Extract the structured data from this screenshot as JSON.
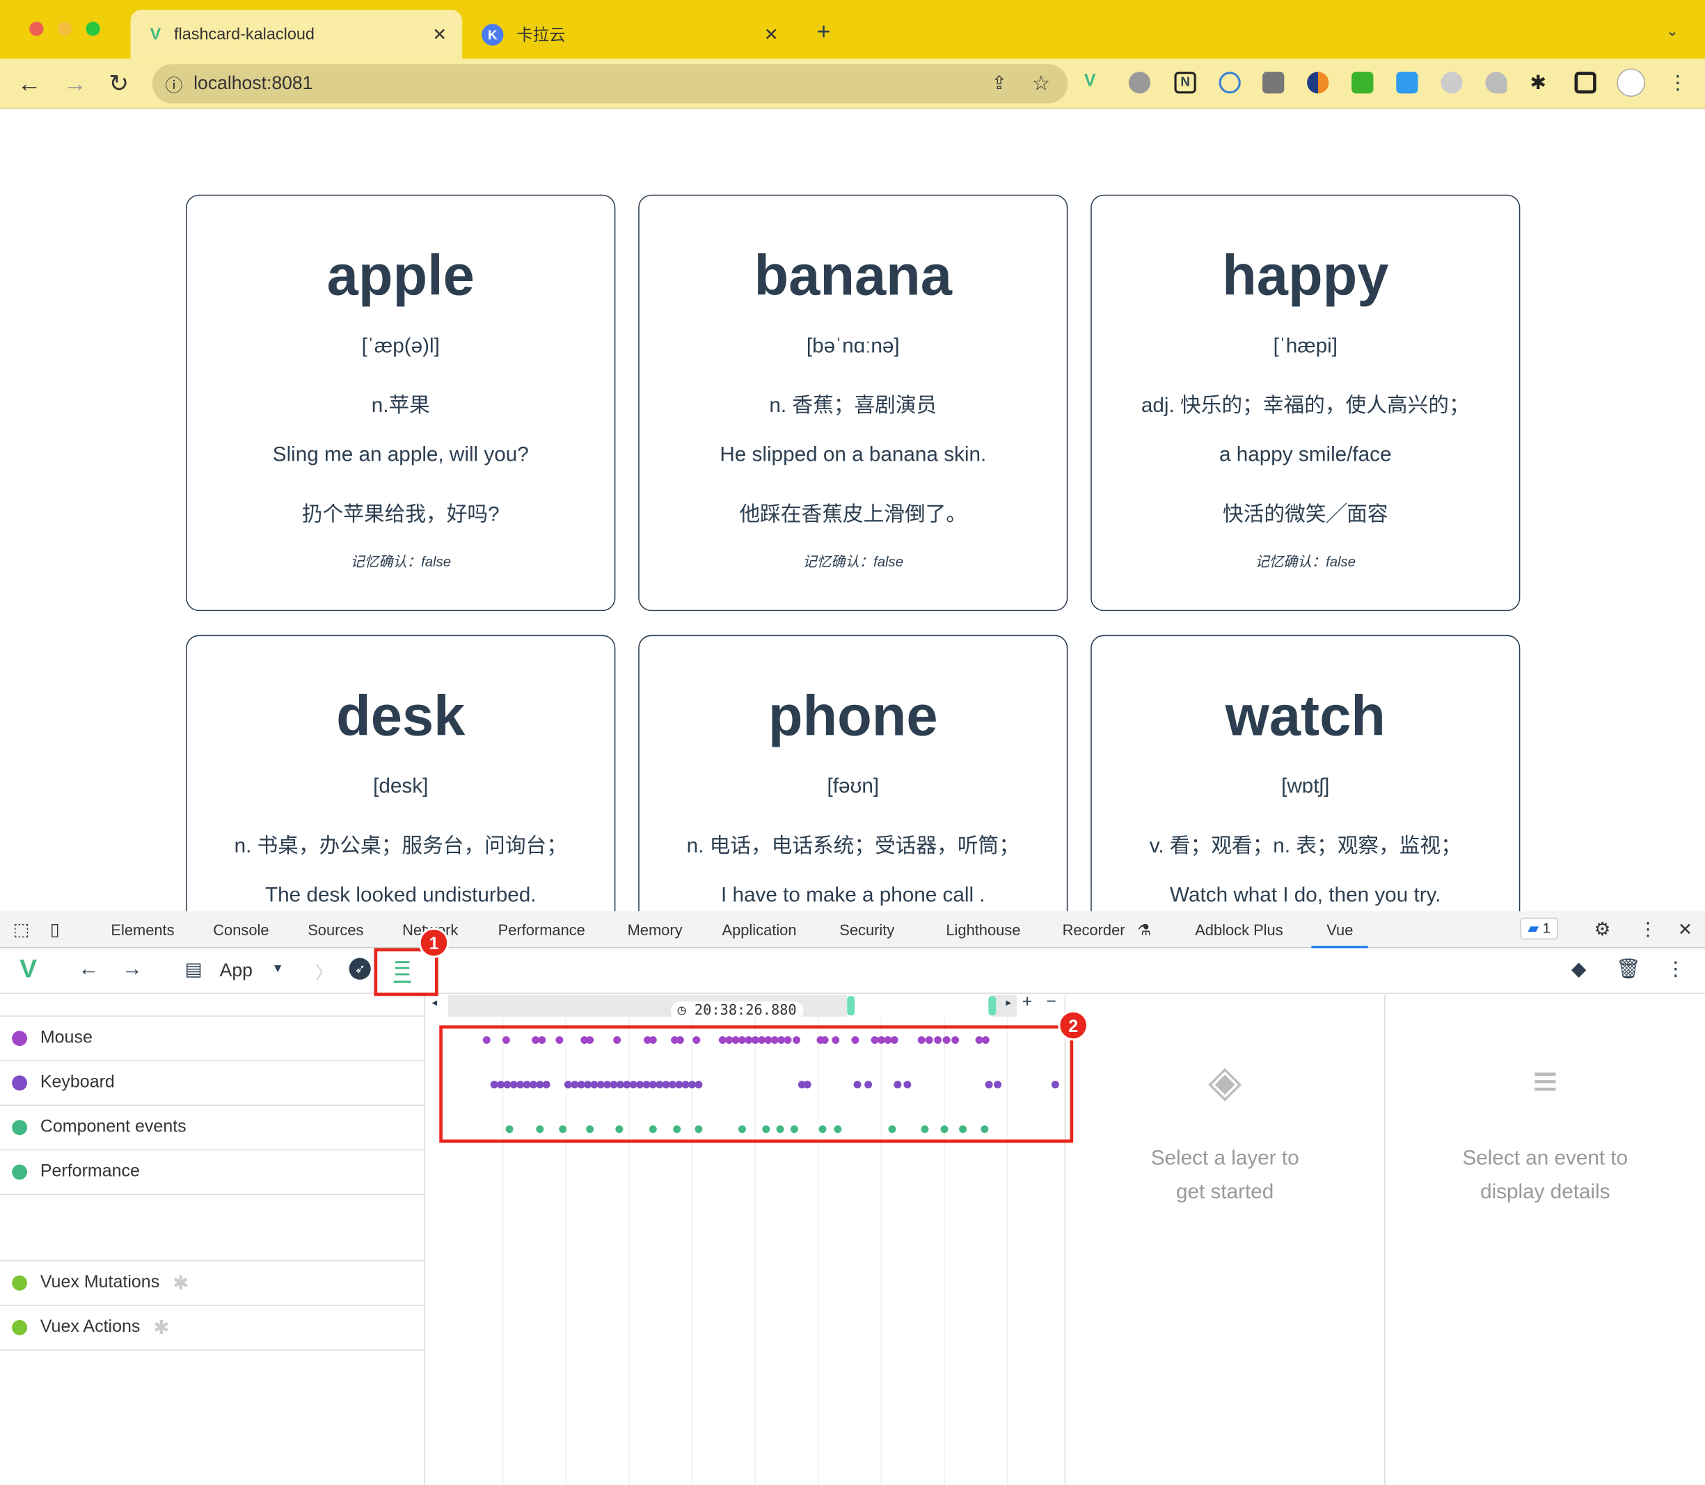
{
  "browser": {
    "tabs": [
      {
        "title": "flashcard-kalacloud",
        "icon": "vue-icon"
      },
      {
        "title": "卡拉云",
        "icon": "kalacloud-icon"
      }
    ],
    "url": "localhost:8081",
    "new_tab": "+"
  },
  "cards": [
    {
      "word": "apple",
      "phonetic": "[ˈæp(ə)l]",
      "meaning": "n.苹果",
      "example": "Sling me an apple, will you?",
      "translation": "扔个苹果给我，好吗?",
      "memory": "记忆确认：false"
    },
    {
      "word": "banana",
      "phonetic": "[bəˈnɑːnə]",
      "meaning": "n. 香蕉；喜剧演员",
      "example": "He slipped on a banana skin.",
      "translation": "他踩在香蕉皮上滑倒了。",
      "memory": "记忆确认：false"
    },
    {
      "word": "happy",
      "phonetic": "[ˈhæpi]",
      "meaning": "adj. 快乐的；幸福的，使人高兴的；",
      "example": "a happy smile/face",
      "translation": "快活的微笑╱面容",
      "memory": "记忆确认：false"
    },
    {
      "word": "desk",
      "phonetic": "[desk]",
      "meaning": "n. 书桌，办公桌；服务台，问询台；",
      "example": "The desk looked undisturbed.",
      "translation": "",
      "memory": ""
    },
    {
      "word": "phone",
      "phonetic": "[fəʊn]",
      "meaning": "n. 电话，电话系统；受话器，听筒；",
      "example": "I have to make a phone call .",
      "translation": "",
      "memory": ""
    },
    {
      "word": "watch",
      "phonetic": "[wɒtʃ]",
      "meaning": "v. 看；观看；n. 表；观察，监视；",
      "example": "Watch what I do, then you try.",
      "translation": "",
      "memory": ""
    }
  ],
  "devtools": {
    "tabs": [
      "Elements",
      "Console",
      "Sources",
      "Network",
      "Performance",
      "Memory",
      "Application",
      "Security",
      "Lighthouse",
      "Recorder",
      "Adblock Plus",
      "Vue"
    ],
    "active_tab": "Vue",
    "issues_count": "1"
  },
  "vue": {
    "app_selector": "App",
    "timestamp": "20:38:26.880",
    "layers": [
      {
        "label": "Mouse",
        "color": "#a044c8"
      },
      {
        "label": "Keyboard",
        "color": "#7e4cc4"
      },
      {
        "label": "Component events",
        "color": "#41b883"
      },
      {
        "label": "Performance",
        "color": "#41b883"
      },
      {
        "label": "Vuex Mutations",
        "color": "#7ac531"
      },
      {
        "label": "Vuex Actions",
        "color": "#7ac531"
      }
    ],
    "empty_layer": "Select a layer to get started",
    "empty_event": "Select an event to display details"
  },
  "annotations": [
    "1",
    "2"
  ],
  "colors": {
    "chrome_tab": "#f0cf0a",
    "accent": "#41b883",
    "annotation": "#e8261c"
  }
}
